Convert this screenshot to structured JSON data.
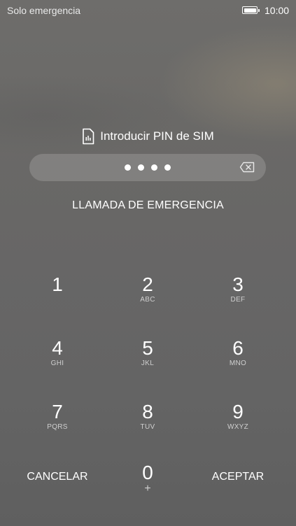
{
  "status_bar": {
    "carrier": "Solo emergencia",
    "time": "10:00",
    "battery_icon": "battery-full-icon"
  },
  "prompt": {
    "icon": "sim-card-icon",
    "text": "Introducir PIN de SIM"
  },
  "pin": {
    "masked_value": "••••",
    "digits_entered": 4,
    "delete_icon": "backspace-icon"
  },
  "emergency_call_label": "LLAMADA DE EMERGENCIA",
  "keypad": {
    "keys": [
      {
        "digit": "1",
        "letters": ""
      },
      {
        "digit": "2",
        "letters": "ABC"
      },
      {
        "digit": "3",
        "letters": "DEF"
      },
      {
        "digit": "4",
        "letters": "GHI"
      },
      {
        "digit": "5",
        "letters": "JKL"
      },
      {
        "digit": "6",
        "letters": "MNO"
      },
      {
        "digit": "7",
        "letters": "PQRS"
      },
      {
        "digit": "8",
        "letters": "TUV"
      },
      {
        "digit": "9",
        "letters": "WXYZ"
      },
      {
        "digit": "0",
        "letters": "+"
      }
    ],
    "cancel_label": "CANCELAR",
    "accept_label": "ACEPTAR"
  }
}
